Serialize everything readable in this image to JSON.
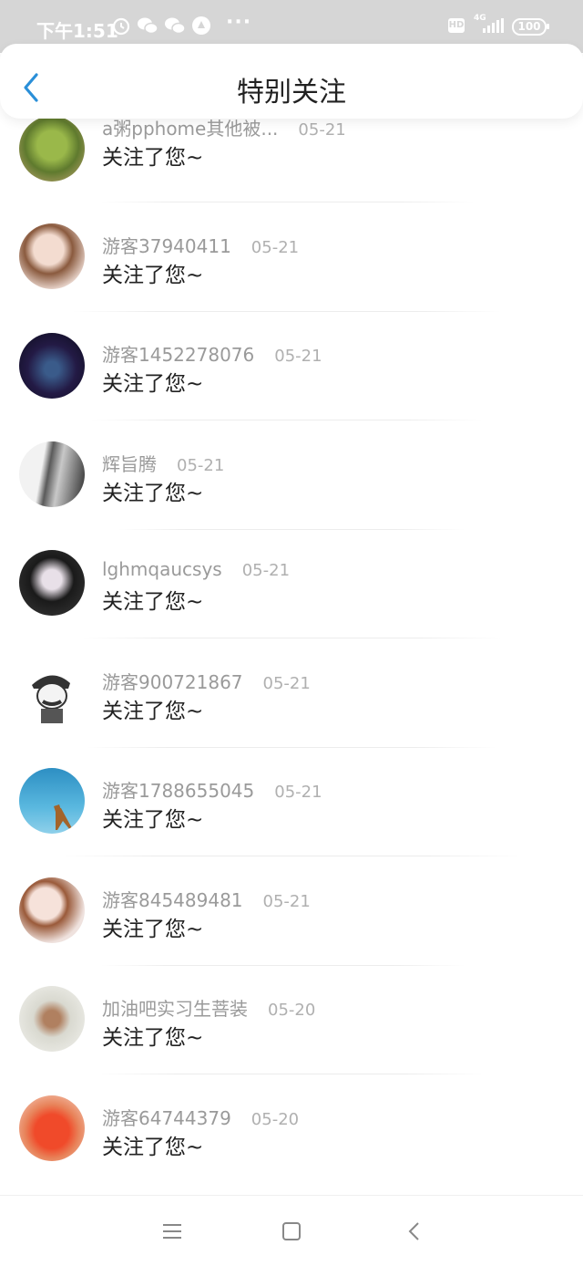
{
  "statusbar": {
    "time": "下午1:51",
    "network": "4G",
    "hd": "HD",
    "battery": "100",
    "more": "···",
    "icons": [
      "alarm-icon",
      "wechat-icon",
      "wechat-icon",
      "app-icon"
    ]
  },
  "header": {
    "title": "特别关注",
    "back_icon": "chevron-left-icon"
  },
  "items": [
    {
      "name": "a粥pphome其他被...",
      "date": "05-21",
      "message": "关注了您~",
      "avatar_color": "#6b8a3a"
    },
    {
      "name": "游客37940411",
      "date": "05-21",
      "message": "关注了您~",
      "avatar_color": "#c99a86"
    },
    {
      "name": "游客1452278076",
      "date": "05-21",
      "message": "关注了您~",
      "avatar_color": "#1b1a3a"
    },
    {
      "name": "辉旨腾",
      "date": "05-21",
      "message": "关注了您~",
      "avatar_color": "#7a7a7a"
    },
    {
      "name": "lghmqaucsys",
      "date": "05-21",
      "message": "关注了您~",
      "avatar_color": "#2a2a2a"
    },
    {
      "name": "游客900721867",
      "date": "05-21",
      "message": "关注了您~",
      "avatar_color": "#ffffff"
    },
    {
      "name": "游客1788655045",
      "date": "05-21",
      "message": "关注了您~",
      "avatar_color": "#3aa6d4"
    },
    {
      "name": "游客845489481",
      "date": "05-21",
      "message": "关注了您~",
      "avatar_color": "#e8c7bf"
    },
    {
      "name": "加油吧实习生菩装",
      "date": "05-20",
      "message": "关注了您~",
      "avatar_color": "#9b6a4a"
    },
    {
      "name": "游客64744379",
      "date": "05-20",
      "message": "关注了您~",
      "avatar_color": "#e34a2a"
    }
  ],
  "navbar": {
    "icons": [
      "menu-icon",
      "home-square-icon",
      "back-triangle-icon"
    ]
  }
}
